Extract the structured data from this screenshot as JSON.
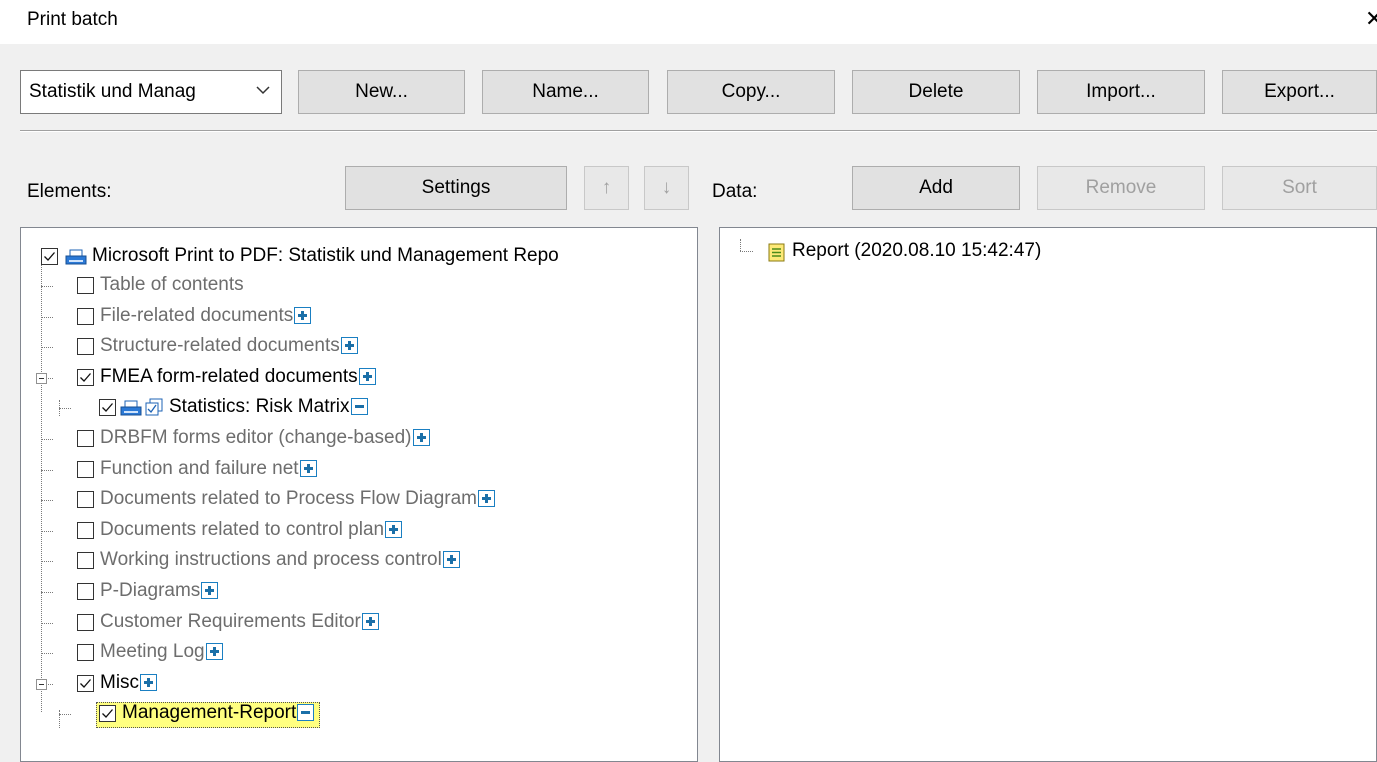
{
  "window": {
    "title": "Print batch",
    "close_glyph": "✕"
  },
  "toolbar": {
    "batch_select_value": "Statistik und Manag",
    "buttons": {
      "new": "New...",
      "name": "Name...",
      "copy": "Copy...",
      "delete": "Delete",
      "import": "Import...",
      "export": "Export..."
    }
  },
  "elements": {
    "label": "Elements:",
    "settings": "Settings",
    "up_arrow": "↑",
    "down_arrow": "↓",
    "root": "Microsoft Print to PDF: Statistik und Management Repo",
    "items": [
      {
        "label": "Table of contents",
        "checked": false,
        "expand": ""
      },
      {
        "label": "File-related documents",
        "checked": false,
        "expand": "plus"
      },
      {
        "label": "Structure-related documents",
        "checked": false,
        "expand": "plus"
      },
      {
        "label": "FMEA form-related documents",
        "checked": true,
        "expand": "plus"
      },
      {
        "label": "Statistics: Risk Matrix",
        "checked": true,
        "expand": "minus"
      },
      {
        "label": "DRBFM forms editor (change-based)",
        "checked": false,
        "expand": "plus"
      },
      {
        "label": "Function and failure net",
        "checked": false,
        "expand": "plus"
      },
      {
        "label": "Documents related to Process Flow Diagram",
        "checked": false,
        "expand": "plus"
      },
      {
        "label": "Documents related to control plan",
        "checked": false,
        "expand": "plus"
      },
      {
        "label": "Working instructions and process control",
        "checked": false,
        "expand": "plus"
      },
      {
        "label": "P-Diagrams",
        "checked": false,
        "expand": "plus"
      },
      {
        "label": "Customer Requirements Editor",
        "checked": false,
        "expand": "plus"
      },
      {
        "label": "Meeting Log",
        "checked": false,
        "expand": "plus"
      },
      {
        "label": "Misc",
        "checked": true,
        "expand": "plus"
      },
      {
        "label": "Management-Report",
        "checked": true,
        "expand": "minus"
      }
    ]
  },
  "data_panel": {
    "label": "Data:",
    "add": "Add",
    "remove": "Remove",
    "sort": "Sort",
    "items": [
      {
        "label": "Report (2020.08.10 15:42:47)"
      }
    ]
  },
  "icons": {
    "printer": "printer-icon",
    "report": "report-icon",
    "check": "checkmark-icon"
  },
  "colors": {
    "highlight": "#ffff80",
    "expand_icon": "#1a6fa8",
    "disabled_text": "#6d6d6d"
  }
}
